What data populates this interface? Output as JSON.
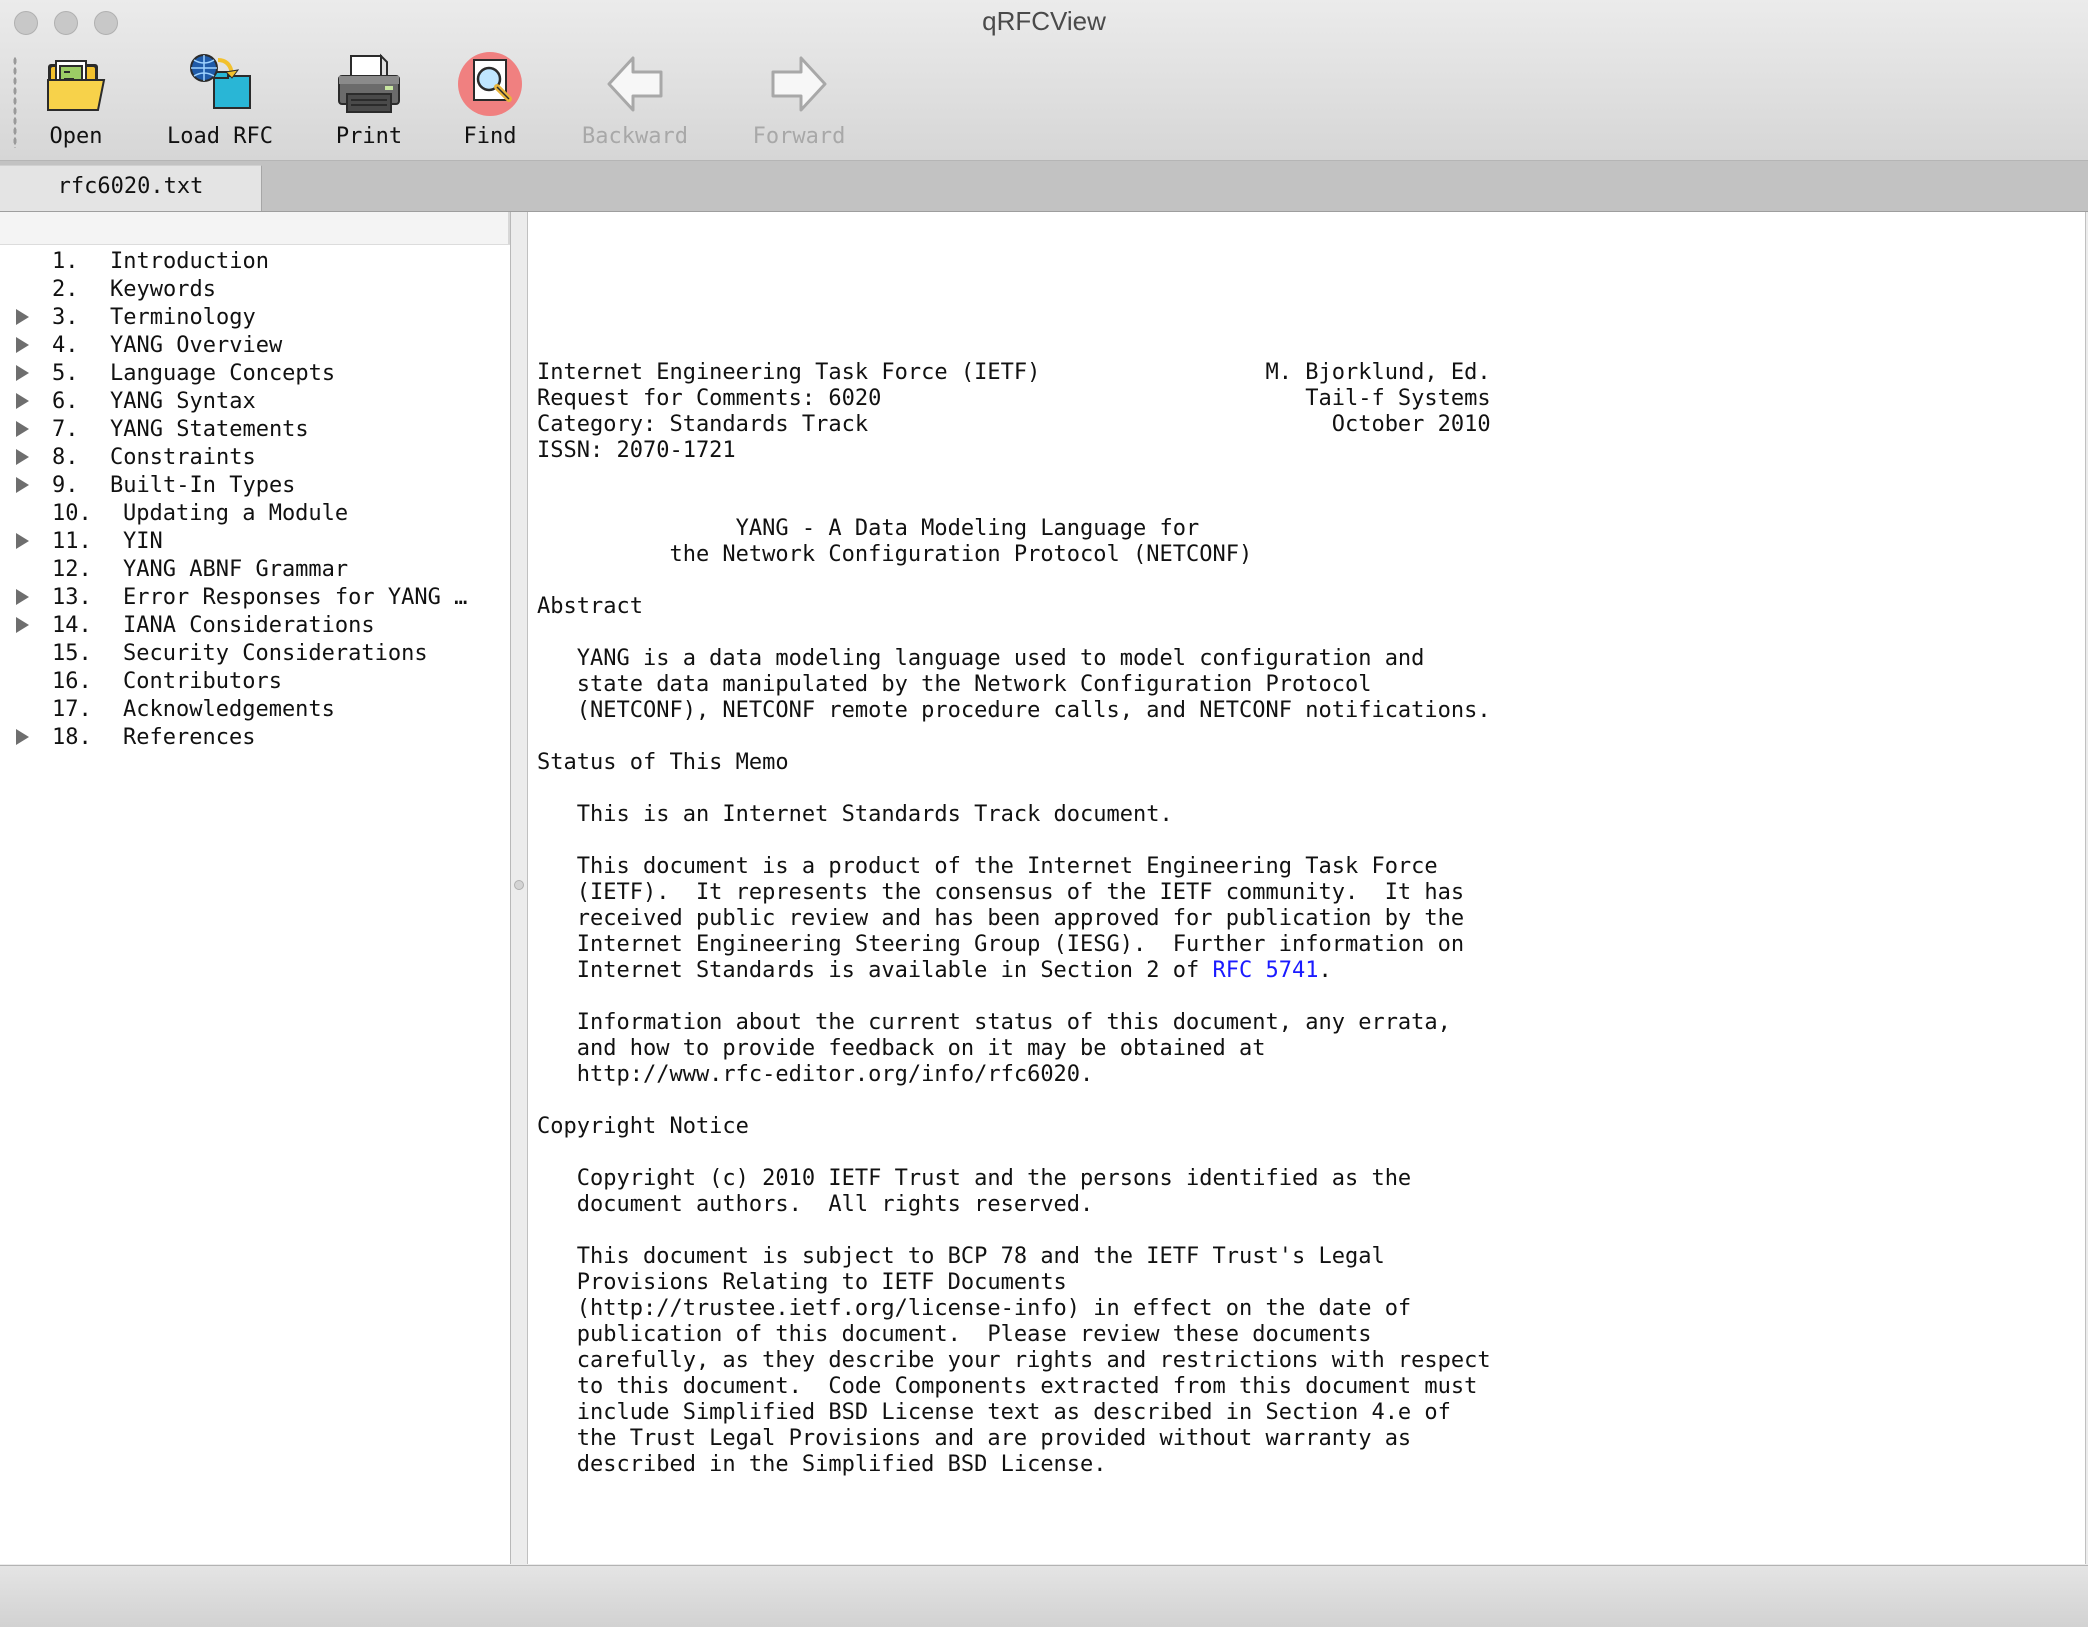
{
  "window": {
    "title": "qRFCView"
  },
  "toolbar": {
    "buttons": [
      {
        "label": "Open",
        "icon": "open-folder-icon",
        "enabled": true
      },
      {
        "label": "Load RFC",
        "icon": "globe-load-icon",
        "enabled": true
      },
      {
        "label": "Print",
        "icon": "printer-icon",
        "enabled": true
      },
      {
        "label": "Find",
        "icon": "magnifier-icon",
        "enabled": true
      },
      {
        "label": "Backward",
        "icon": "arrow-left-icon",
        "enabled": false
      },
      {
        "label": "Forward",
        "icon": "arrow-right-icon",
        "enabled": false
      }
    ]
  },
  "tabs": [
    {
      "label": "rfc6020.txt",
      "active": true
    }
  ],
  "toc": {
    "items": [
      {
        "num": "1.",
        "title": "Introduction",
        "expandable": false
      },
      {
        "num": "2.",
        "title": "Keywords",
        "expandable": false
      },
      {
        "num": "3.",
        "title": "Terminology",
        "expandable": true
      },
      {
        "num": "4.",
        "title": "YANG Overview",
        "expandable": true
      },
      {
        "num": "5.",
        "title": "Language Concepts",
        "expandable": true
      },
      {
        "num": "6.",
        "title": "YANG Syntax",
        "expandable": true
      },
      {
        "num": "7.",
        "title": "YANG Statements",
        "expandable": true
      },
      {
        "num": "8.",
        "title": "Constraints",
        "expandable": true
      },
      {
        "num": "9.",
        "title": "Built-In Types",
        "expandable": true
      },
      {
        "num": "10.",
        "title": "Updating a Module",
        "expandable": false
      },
      {
        "num": "11.",
        "title": "YIN",
        "expandable": true
      },
      {
        "num": "12.",
        "title": "YANG ABNF Grammar",
        "expandable": false
      },
      {
        "num": "13.",
        "title": "Error Responses for YANG …",
        "expandable": true
      },
      {
        "num": "14.",
        "title": "IANA Considerations",
        "expandable": true
      },
      {
        "num": "15.",
        "title": "Security Considerations",
        "expandable": false
      },
      {
        "num": "16.",
        "title": "Contributors",
        "expandable": false
      },
      {
        "num": "17.",
        "title": "Acknowledgements",
        "expandable": false
      },
      {
        "num": "18.",
        "title": "References",
        "expandable": true
      }
    ]
  },
  "document": {
    "lines": [
      "Internet Engineering Task Force (IETF)                 M. Bjorklund, Ed.",
      "Request for Comments: 6020                                Tail-f Systems",
      "Category: Standards Track                                   October 2010",
      "ISSN: 2070-1721",
      "",
      "",
      "               YANG - A Data Modeling Language for",
      "          the Network Configuration Protocol (NETCONF)",
      "",
      "Abstract",
      "",
      "   YANG is a data modeling language used to model configuration and",
      "   state data manipulated by the Network Configuration Protocol",
      "   (NETCONF), NETCONF remote procedure calls, and NETCONF notifications.",
      "",
      "Status of This Memo",
      "",
      "   This is an Internet Standards Track document.",
      "",
      "   This document is a product of the Internet Engineering Task Force",
      "   (IETF).  It represents the consensus of the IETF community.  It has",
      "   received public review and has been approved for publication by the",
      "   Internet Engineering Steering Group (IESG).  Further information on",
      "   Internet Standards is available in Section 2 of ",
      "",
      "   Information about the current status of this document, any errata,",
      "   and how to provide feedback on it may be obtained at",
      "   http://www.rfc-editor.org/info/rfc6020.",
      "",
      "Copyright Notice",
      "",
      "   Copyright (c) 2010 IETF Trust and the persons identified as the",
      "   document authors.  All rights reserved.",
      "",
      "   This document is subject to BCP 78 and the IETF Trust's Legal",
      "   Provisions Relating to IETF Documents",
      "   (http://trustee.ietf.org/license-info) in effect on the date of",
      "   publication of this document.  Please review these documents",
      "   carefully, as they describe your rights and restrictions with respect",
      "   to this document.  Code Components extracted from this document must",
      "   include Simplified BSD License text as described in Section 4.e of",
      "   the Trust Legal Provisions and are provided without warranty as",
      "   described in the Simplified BSD License."
    ],
    "link_line_index": 23,
    "link_text": "RFC 5741",
    "link_suffix": ".",
    "link_color": "#1a1aff"
  },
  "statusbar": {
    "text": ""
  }
}
